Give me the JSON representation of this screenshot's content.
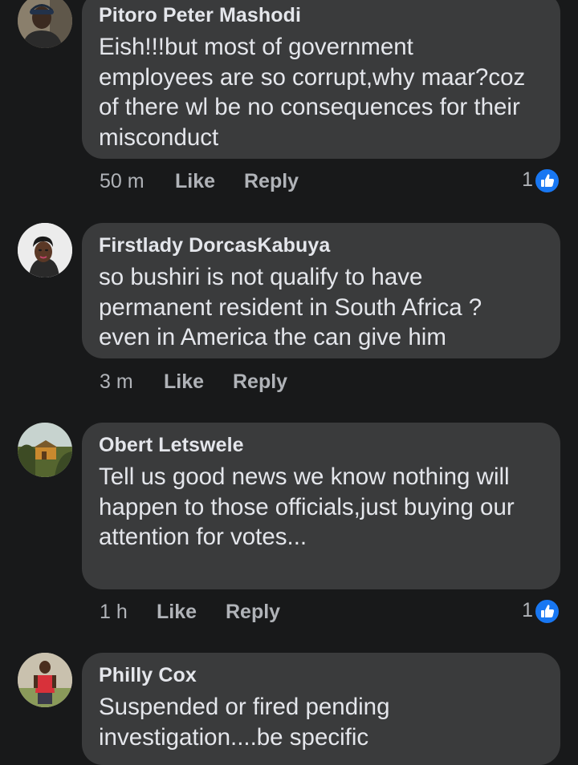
{
  "colors": {
    "background": "#18191a",
    "bubble": "#3a3b3c",
    "text_primary": "#e4e6eb",
    "text_secondary": "#b0b3b8",
    "like_blue": "#1877f2"
  },
  "comments": [
    {
      "author": "Pitoro Peter Mashodi",
      "text": "Eish!!!but most of government\nemployees are so corrupt,why maar?coz\nof there wl be no consequences for their\nmisconduct",
      "time": "50 m",
      "like_label": "Like",
      "reply_label": "Reply",
      "reaction_count": "1",
      "reaction_icon": "thumbs-up-icon"
    },
    {
      "author": "Firstlady DorcasKabuya",
      "text": "so bushiri is not qualify to have\npermanent resident in South Africa ?\neven in America the can give him",
      "time": "3 m",
      "like_label": "Like",
      "reply_label": "Reply"
    },
    {
      "author": "Obert Letswele",
      "text": "Tell us good news we know nothing will\nhappen to those officials,just buying our\nattention for votes...",
      "time": "1 h",
      "like_label": "Like",
      "reply_label": "Reply",
      "reaction_count": "1",
      "reaction_icon": "thumbs-up-icon"
    },
    {
      "author": "Philly Cox",
      "text": "Suspended or fired pending\ninvestigation....be specific"
    }
  ]
}
